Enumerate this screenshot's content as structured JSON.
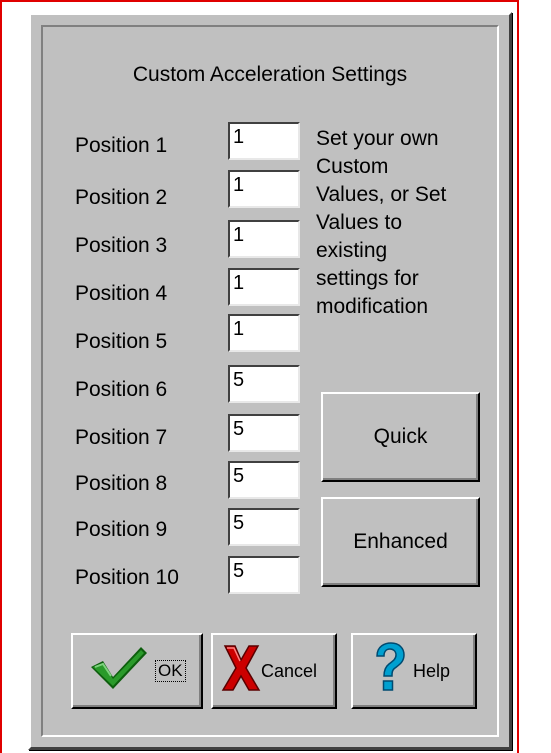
{
  "dialog": {
    "title": "Custom Acceleration Settings"
  },
  "positions": [
    {
      "label": "Position 1",
      "value": "1"
    },
    {
      "label": "Position 2",
      "value": "1"
    },
    {
      "label": "Position 3",
      "value": "1"
    },
    {
      "label": "Position 4",
      "value": "1"
    },
    {
      "label": "Position 5",
      "value": "1"
    },
    {
      "label": "Position 6",
      "value": "5"
    },
    {
      "label": "Position 7",
      "value": "5"
    },
    {
      "label": "Position 8",
      "value": "5"
    },
    {
      "label": "Position 9",
      "value": "5"
    },
    {
      "label": "Position 10",
      "value": "5"
    }
  ],
  "hint": {
    "lines": [
      "Set your own",
      "Custom",
      "Values, or Set",
      "Values to",
      "existing",
      "settings for",
      "modification"
    ]
  },
  "buttons": {
    "quick": "Quick",
    "enhanced": "Enhanced",
    "ok": "OK",
    "cancel": "Cancel",
    "help": "Help"
  },
  "icons": {
    "ok": "checkmark-icon",
    "cancel": "red-x-icon",
    "help": "question-mark-icon"
  },
  "colors": {
    "dialog_bg": "#c0c0c0",
    "frame_red": "#e00000",
    "check_green": "#2a9a2a",
    "cancel_red": "#cc0000",
    "help_cyan": "#00a0d0"
  }
}
